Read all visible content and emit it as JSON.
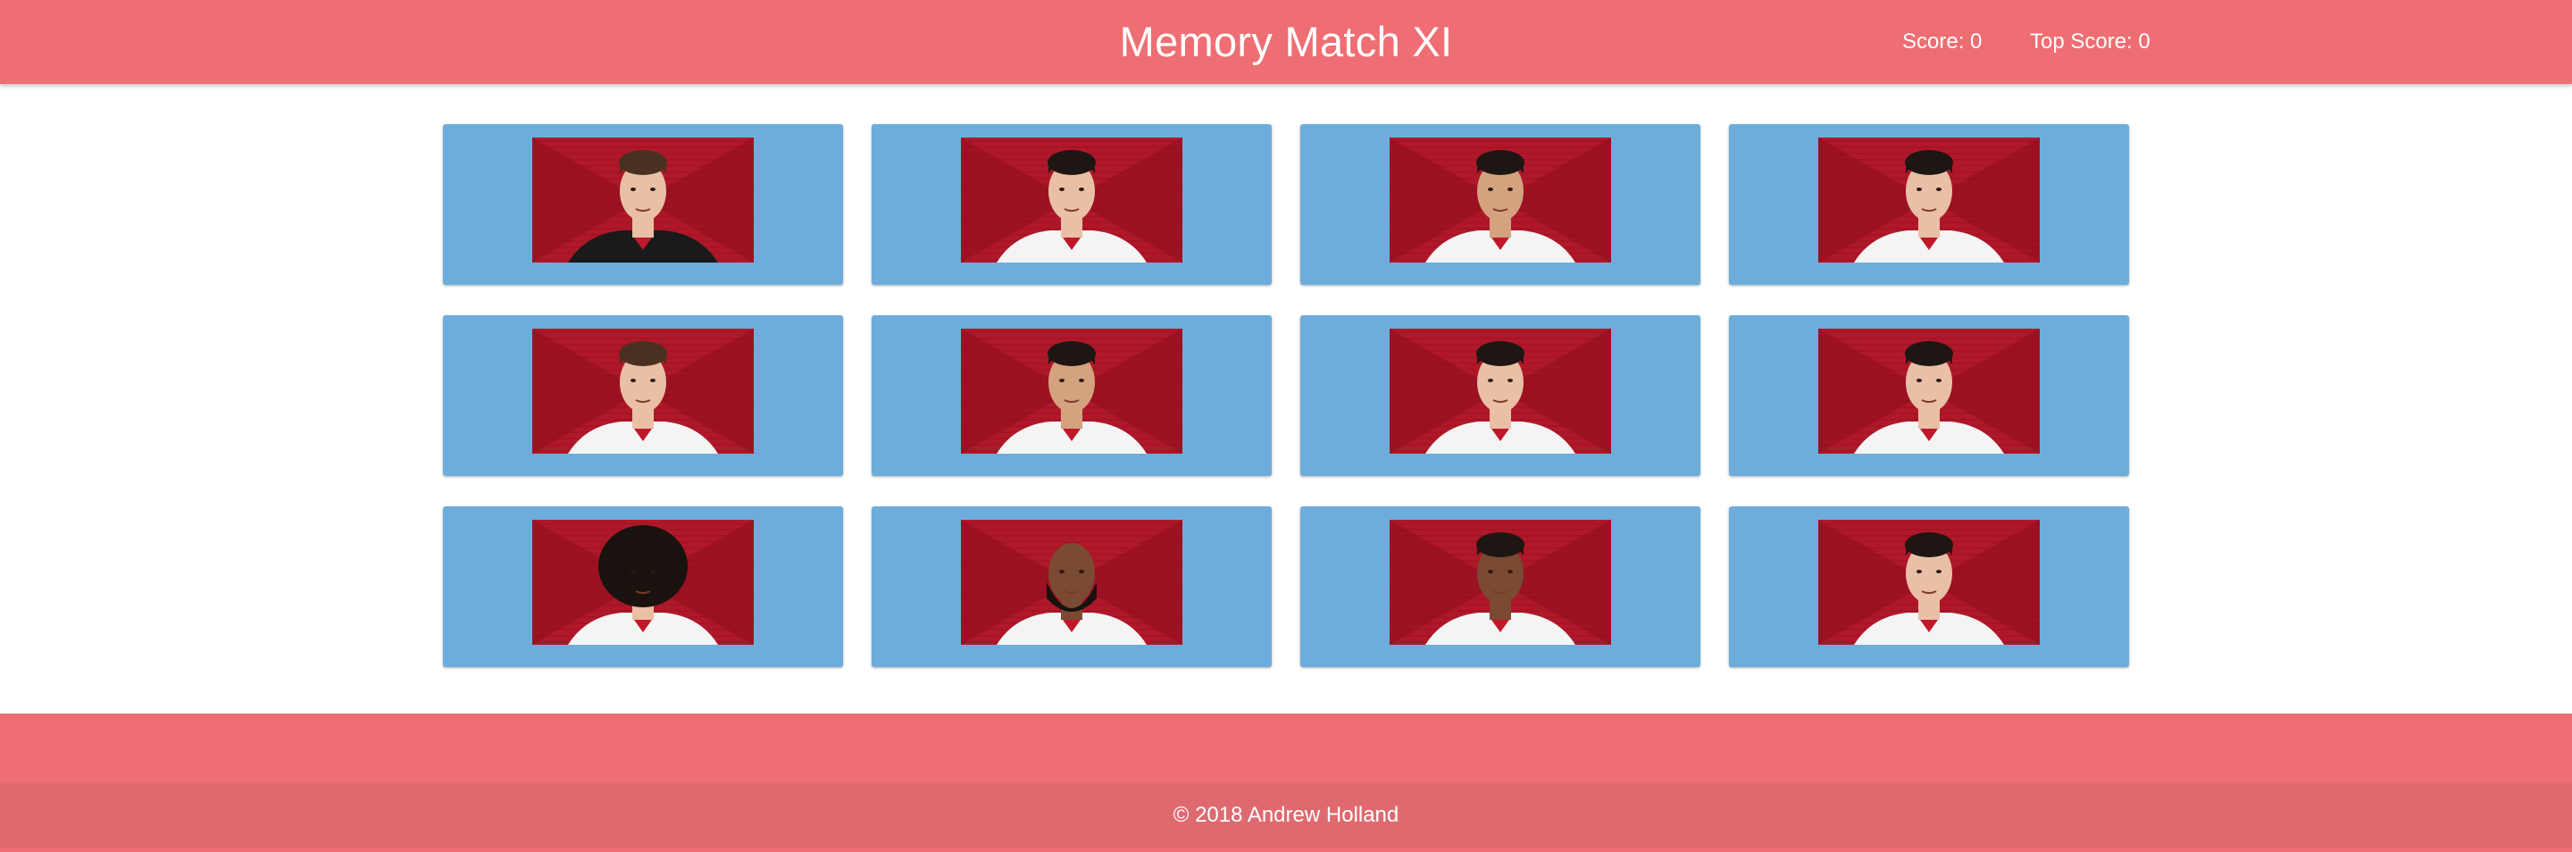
{
  "header": {
    "title": "Memory Match XI",
    "score_label": "Score: 0",
    "top_score_label": "Top Score: 0"
  },
  "game": {
    "score": 0,
    "top_score": 0,
    "cards": [
      {
        "kit": "dark",
        "hair": "short-brown",
        "skin": "light"
      },
      {
        "kit": "white",
        "hair": "short-dark",
        "skin": "light"
      },
      {
        "kit": "white",
        "hair": "short-dark",
        "skin": "tan"
      },
      {
        "kit": "white",
        "hair": "short-dark",
        "skin": "light"
      },
      {
        "kit": "white",
        "hair": "short-brown",
        "skin": "light"
      },
      {
        "kit": "white",
        "hair": "short-dark",
        "skin": "tan"
      },
      {
        "kit": "white",
        "hair": "short-dark",
        "skin": "light"
      },
      {
        "kit": "white",
        "hair": "short-dark",
        "skin": "light"
      },
      {
        "kit": "white",
        "hair": "curly-long",
        "skin": "light"
      },
      {
        "kit": "white",
        "hair": "bald-beard",
        "skin": "dark"
      },
      {
        "kit": "white",
        "hair": "short-dark",
        "skin": "dark"
      },
      {
        "kit": "white",
        "hair": "short-dark",
        "skin": "light"
      }
    ]
  },
  "colors": {
    "navbar": "#ee6e73",
    "card": "#6eaddb",
    "portrait_bg": "#b0182a",
    "footer_bar": "#de6a70"
  },
  "footer": {
    "copyright": "© 2018 Andrew Holland"
  }
}
